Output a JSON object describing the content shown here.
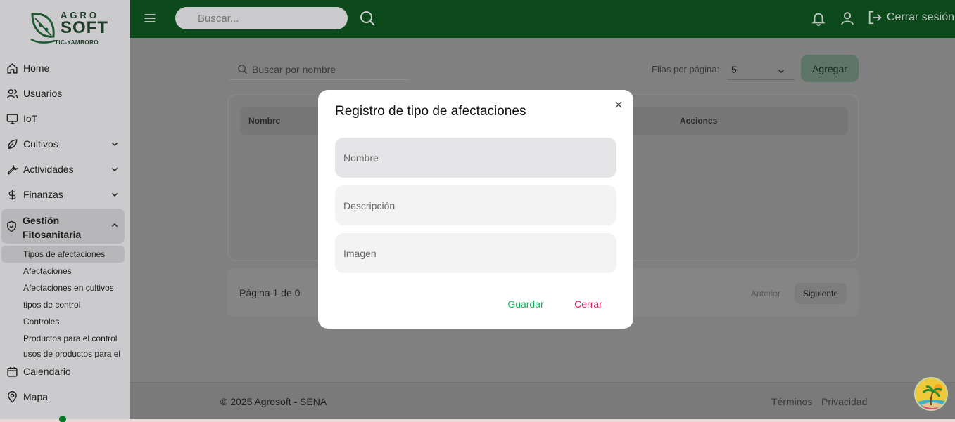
{
  "brand": {
    "line1": "AGRO",
    "line2": "SOFT",
    "line3": "TIC-YAMBORÓ"
  },
  "topbar": {
    "search_placeholder": "Buscar...",
    "logout_label": "Cerrar sesión"
  },
  "sidebar": {
    "items": [
      {
        "label": "Home",
        "icon": "home-icon"
      },
      {
        "label": "Usuarios",
        "icon": "users-icon"
      },
      {
        "label": "IoT",
        "icon": "monitor-icon"
      },
      {
        "label": "Cultivos",
        "icon": "leaf-icon"
      },
      {
        "label": "Actividades",
        "icon": "wrench-icon"
      },
      {
        "label": "Finanzas",
        "icon": "dollar-icon"
      }
    ],
    "active_section": "Gestión Fitosanitaria",
    "sub_items": [
      "Tipos de afectaciones",
      "Afectaciones",
      "Afectaciones en cultivos",
      "tipos de control",
      "Controles",
      "Productos para el control",
      "usos de productos para el"
    ],
    "bottom_items": [
      {
        "label": "Calendario",
        "icon": "calendar-icon"
      },
      {
        "label": "Mapa",
        "icon": "map-pin-icon"
      }
    ]
  },
  "list": {
    "search_placeholder": "Buscar por nombre",
    "rows_per_page_label": "Filas por página:",
    "rows_per_page_value": "5",
    "add_label": "Agregar",
    "columns": [
      "Nombre",
      "Acciones"
    ],
    "pagination_info": "Página 1 de 0",
    "prev_label": "Anterior",
    "next_label": "Siguiente"
  },
  "modal": {
    "title": "Registro de tipo de afectaciones",
    "fields": [
      "Nombre",
      "Descripción",
      "Imagen"
    ],
    "save_label": "Guardar",
    "close_label": "Cerrar"
  },
  "footer": {
    "copyright": "© 2025 Agrosoft - SENA",
    "terms": "Términos",
    "privacy": "Privacidad"
  },
  "colors": {
    "topbar": "#0c4a1c",
    "save": "#17b35a",
    "close": "#e5195e"
  }
}
